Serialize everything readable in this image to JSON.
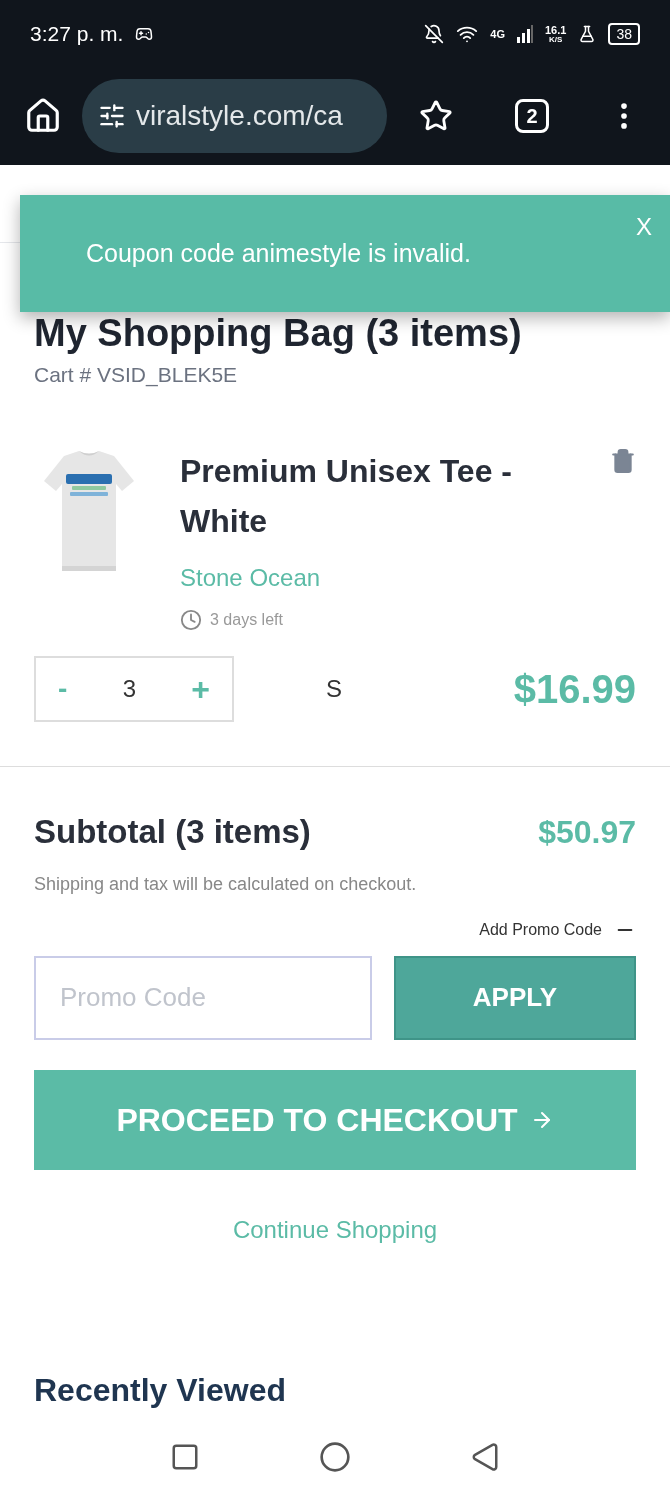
{
  "status_bar": {
    "time": "3:27 p. m.",
    "network": "4G",
    "speed_value": "16.1",
    "speed_unit": "K/S",
    "battery": "38"
  },
  "browser": {
    "url": "viralstyle.com/ca",
    "tab_count": "2"
  },
  "toast": {
    "message": "Coupon code animestyle is invalid.",
    "close": "X"
  },
  "cart": {
    "title": "My Shopping Bag (3 items)",
    "cart_id": "Cart # VSID_BLEK5E"
  },
  "items": [
    {
      "name": "Premium Unisex Tee - White",
      "design": "Stone Ocean",
      "time_left": "3 days left",
      "decrement": "-",
      "quantity": "3",
      "increment": "+",
      "size": "S",
      "price": "$16.99"
    }
  ],
  "summary": {
    "subtotal_label": "Subtotal (3 items)",
    "subtotal": "$50.97",
    "note": "Shipping and tax will be calculated on checkout.",
    "promo_toggle": "Add Promo Code",
    "promo_expanded": true,
    "promo_placeholder": "Promo Code",
    "apply": "APPLY",
    "checkout": "PROCEED TO CHECKOUT",
    "continue": "Continue Shopping"
  },
  "recently_viewed": {
    "title": "Recently Viewed"
  }
}
